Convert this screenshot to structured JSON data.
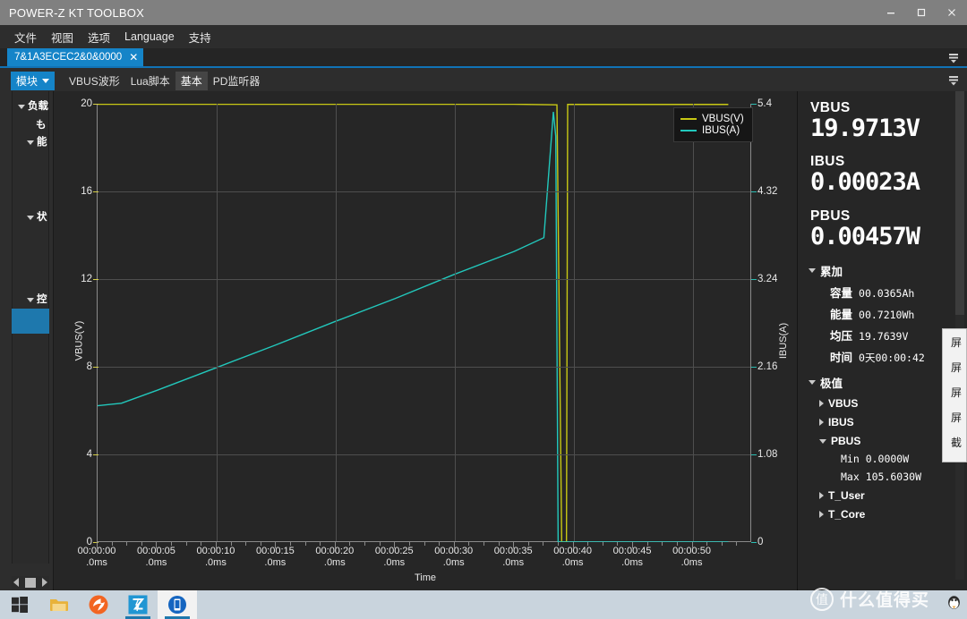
{
  "window": {
    "title": "POWER-Z KT TOOLBOX",
    "minimize_label": "minimize",
    "maximize_label": "maximize",
    "close_label": "close"
  },
  "menu": {
    "items": [
      "文件",
      "视图",
      "选项",
      "Language",
      "支持"
    ]
  },
  "tabs": {
    "document_tab": "7&1A3ECEC2&0&0000",
    "close_glyph": "✕"
  },
  "module_bar": {
    "module_button": "模块",
    "tabs": [
      {
        "label": "VBUS波形",
        "active": false
      },
      {
        "label": "Lua脚本",
        "active": false
      },
      {
        "label": "基本",
        "active": true
      },
      {
        "label": "PD监听器",
        "active": false
      }
    ]
  },
  "sidebar": {
    "items": [
      {
        "label": "负载",
        "expanded": true
      },
      {
        "label": "も",
        "expanded": false
      },
      {
        "label": "能",
        "expanded": true
      },
      {
        "label": "状",
        "expanded": true
      },
      {
        "label": "控",
        "expanded": true
      }
    ]
  },
  "chart_data": {
    "type": "line",
    "title": "",
    "xlabel": "Time",
    "ylabel": "VBUS(V)",
    "y2label": "IBUS(A)",
    "grid": true,
    "legend_position": "top-right",
    "xlim": [
      0,
      55
    ],
    "ylim": [
      0,
      20
    ],
    "y2lim": [
      0,
      5.4
    ],
    "x_tick_labels": [
      "00:00:00\n.0ms",
      "00:00:05\n.0ms",
      "00:00:10\n.0ms",
      "00:00:15\n.0ms",
      "00:00:20\n.0ms",
      "00:00:25\n.0ms",
      "00:00:30\n.0ms",
      "00:00:35\n.0ms",
      "00:00:40\n.0ms",
      "00:00:45\n.0ms",
      "00:00:50\n.0ms"
    ],
    "x_ticks": [
      0,
      5,
      10,
      15,
      20,
      25,
      30,
      35,
      40,
      45,
      50
    ],
    "y_ticks": [
      0,
      4,
      8,
      12,
      16,
      20
    ],
    "y2_ticks": [
      0,
      1.08,
      2.16,
      3.24,
      4.32,
      5.4
    ],
    "series": [
      {
        "name": "VBUS(V)",
        "color": "#c8c814",
        "axis": "left",
        "x": [
          0,
          2,
          5,
          10,
          15,
          20,
          25,
          30,
          35,
          38.6,
          39.0,
          39.1,
          39.4,
          39.5,
          40,
          45,
          50,
          53
        ],
        "values": [
          19.98,
          19.98,
          19.98,
          19.98,
          19.98,
          19.98,
          19.98,
          19.98,
          19.98,
          19.95,
          0.0,
          0.0,
          0.0,
          19.97,
          19.97,
          19.97,
          19.97,
          19.97
        ]
      },
      {
        "name": "IBUS(A)",
        "color": "#22c8bc",
        "axis": "right",
        "x": [
          0,
          2,
          5,
          10,
          15,
          20,
          25,
          30,
          35,
          37.5,
          38.3,
          38.5,
          38.7,
          39,
          40,
          45,
          50,
          53
        ],
        "values": [
          1.68,
          1.71,
          1.87,
          2.15,
          2.43,
          2.72,
          3.0,
          3.3,
          3.58,
          3.75,
          5.3,
          5.0,
          0.0,
          0.0,
          0.0,
          0.0,
          0.0,
          0.0
        ]
      }
    ],
    "annotations": []
  },
  "readout": {
    "vbus_label": "VBUS",
    "vbus_value": "19.9713V",
    "ibus_label": "IBUS",
    "ibus_value": "0.00023A",
    "pbus_label": "PBUS",
    "pbus_value": "0.00457W",
    "accumulate": {
      "title": "累加",
      "rows": [
        {
          "key": "容量",
          "value": "00.0365Ah"
        },
        {
          "key": "能量",
          "value": "00.7210Wh"
        },
        {
          "key": "均压",
          "value": "19.7639V"
        },
        {
          "key": "时间",
          "value": "0天00:00:42"
        }
      ]
    },
    "extremes": {
      "title": "极值",
      "groups": [
        {
          "name": "VBUS",
          "expanded": false,
          "rows": []
        },
        {
          "name": "IBUS",
          "expanded": false,
          "rows": []
        },
        {
          "name": "PBUS",
          "expanded": true,
          "rows": [
            "Min 0.0000W",
            "Max 105.6030W"
          ]
        },
        {
          "name": "T_User",
          "expanded": false,
          "rows": []
        },
        {
          "name": "T_Core",
          "expanded": false,
          "rows": []
        }
      ]
    }
  },
  "context_menu": {
    "items": [
      "屏",
      "屏",
      "屏",
      "屏",
      "截"
    ]
  },
  "taskbar": {
    "items": [
      {
        "name": "start-button",
        "glyph": "⊞"
      },
      {
        "name": "file-explorer",
        "glyph": "🗀"
      },
      {
        "name": "thunder-app",
        "glyph": "⚡"
      },
      {
        "name": "power-z-app",
        "glyph": "Z"
      },
      {
        "name": "phone-app",
        "glyph": "▯"
      }
    ]
  },
  "watermark": {
    "badge": "值",
    "text": "什么值得买"
  },
  "colors": {
    "accent": "#1584c8",
    "vbus": "#c8c814",
    "ibus": "#22c8bc",
    "panel_bg": "#262626",
    "window_bg": "#2d2d2d"
  }
}
